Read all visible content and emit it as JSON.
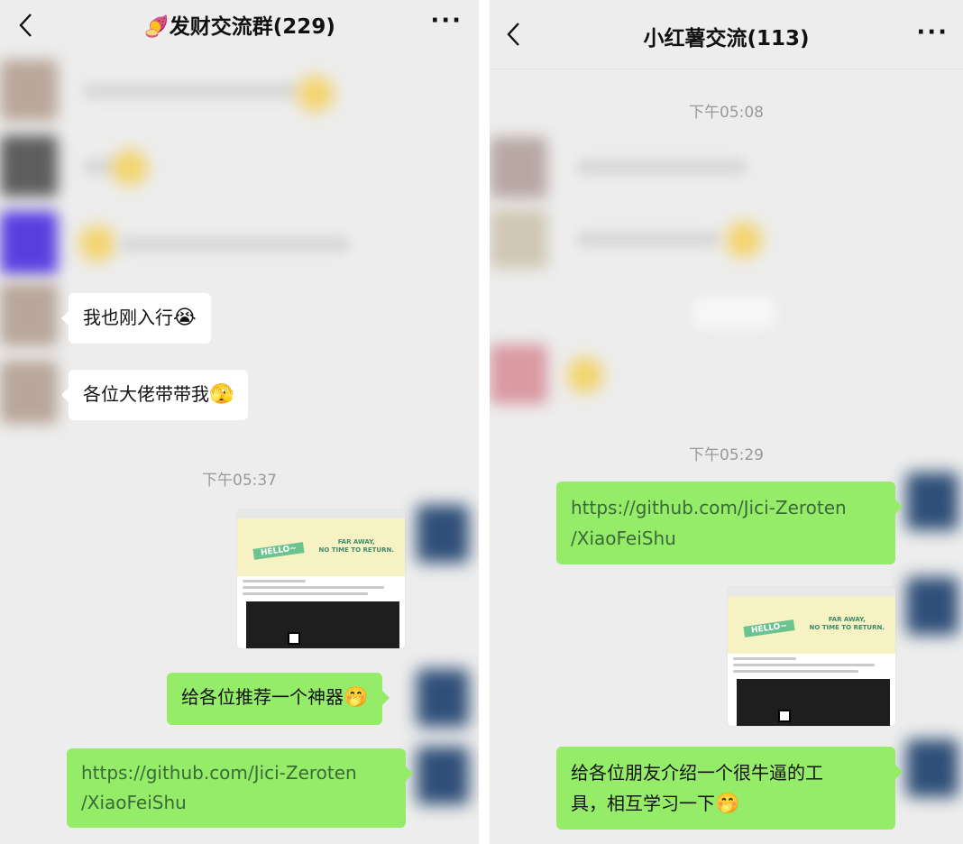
{
  "left_chat": {
    "title": "发财交流群(229)",
    "title_emoji": "🍠",
    "more": "···",
    "messages": [
      {
        "text": "我也刚入行",
        "emoji": "😭"
      },
      {
        "text": "各位大佬带带我",
        "emoji": "🫣"
      }
    ],
    "time": "下午05:37",
    "screenshot": {
      "hello": "HELLO~",
      "far_away": "FAR AWAY,",
      "no_time": "NO TIME TO RETURN."
    },
    "my_messages": [
      {
        "text": "给各位推荐一个神器",
        "emoji": "🤭"
      },
      {
        "line1": "https://github.com/Jici-Zeroten",
        "line2": "/XiaoFeiShu"
      }
    ]
  },
  "right_chat": {
    "title": "小红薯交流(113)",
    "more": "···",
    "time1": "下午05:08",
    "time2": "下午05:29",
    "screenshot": {
      "hello": "HELLO~",
      "far_away": "FAR AWAY,",
      "no_time": "NO TIME TO RETURN."
    },
    "my_messages": [
      {
        "line1": "https://github.com/Jici-Zeroten",
        "line2": "/XiaoFeiShu"
      },
      {
        "line1": "给各位朋友介绍一个很牛逼的工",
        "line2": "具，相互学习一下",
        "emoji": "🤭"
      }
    ]
  },
  "colors": {
    "chat_bg": "#ededed",
    "my_bubble": "#95ec69",
    "other_bubble": "#ffffff",
    "time_text": "#999999"
  }
}
